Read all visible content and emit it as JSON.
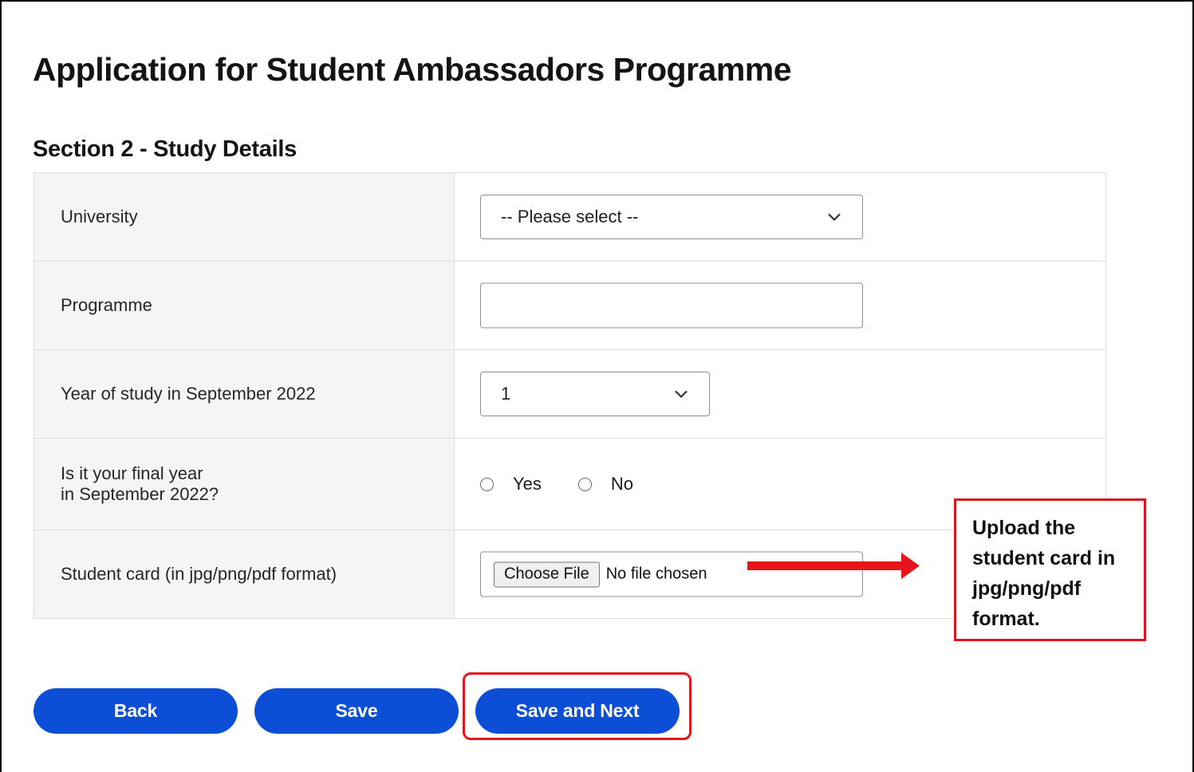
{
  "page": {
    "title": "Application for Student Ambassadors Programme",
    "section_title": "Section 2 - Study Details"
  },
  "form": {
    "university": {
      "label": "University",
      "selected": "-- Please select --"
    },
    "programme": {
      "label": "Programme",
      "value": ""
    },
    "year_of_study": {
      "label": "Year of study in September 2022",
      "selected": "1"
    },
    "final_year": {
      "label_line1": "Is it your final year",
      "label_line2": "in September 2022?",
      "options": [
        "Yes",
        "No"
      ]
    },
    "student_card": {
      "label": "Student card (in jpg/png/pdf format)",
      "button_label": "Choose File",
      "status": "No file chosen"
    }
  },
  "buttons": {
    "back": "Back",
    "save": "Save",
    "save_next": "Save and Next"
  },
  "annotation": {
    "callout_lines": [
      "Upload the",
      "student card in",
      "jpg/png/pdf",
      "format."
    ],
    "accent_color": "#e8141c"
  },
  "colors": {
    "button_blue": "#0c4fd6",
    "label_bg": "#f5f5f5"
  }
}
